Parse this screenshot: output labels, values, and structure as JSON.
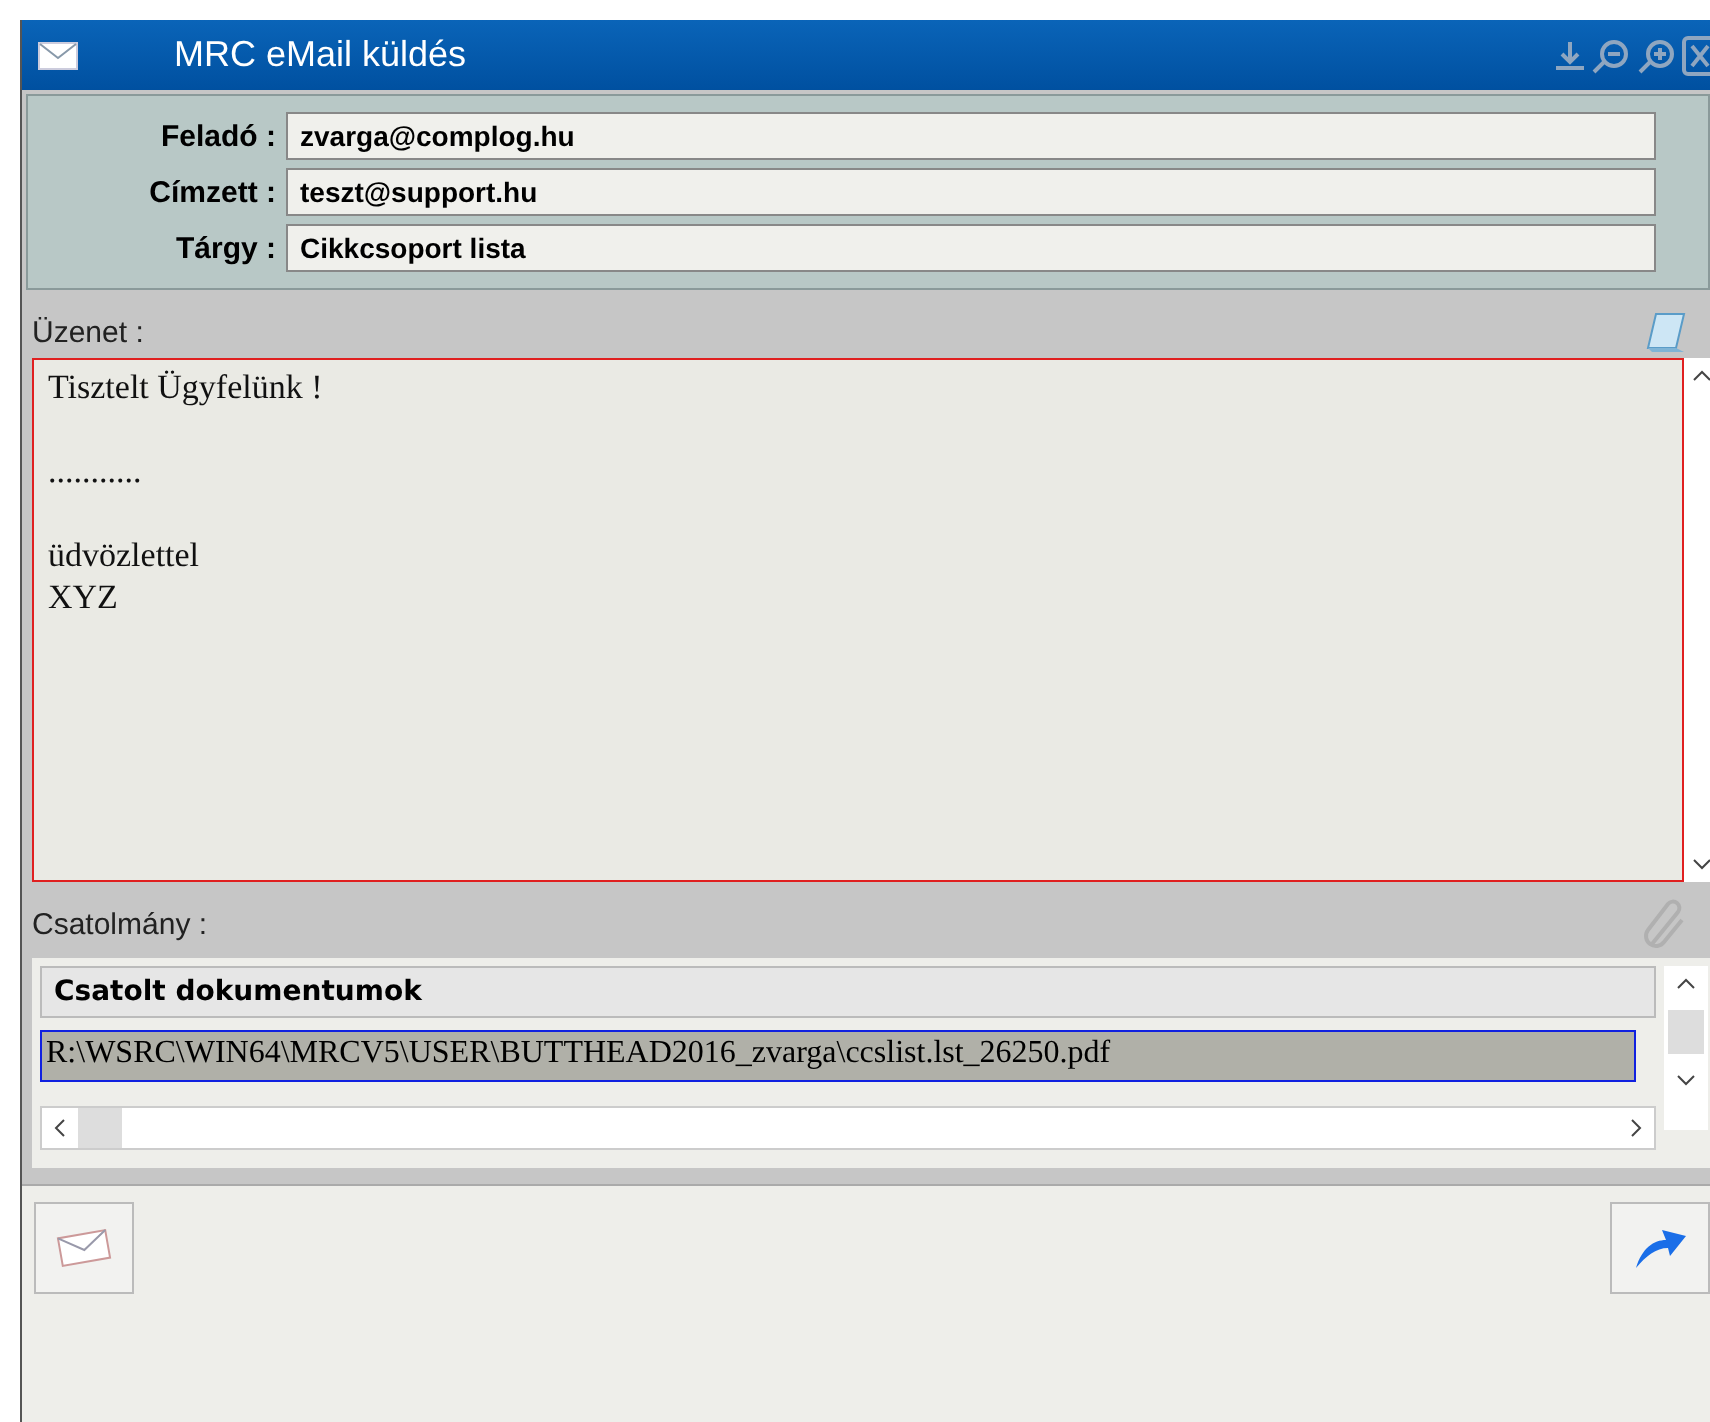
{
  "window": {
    "title": "MRC eMail küldés"
  },
  "header_fields": [
    {
      "label": "Feladó :",
      "value": "zvarga@complog.hu"
    },
    {
      "label": "Címzett :",
      "value": "teszt@support.hu"
    },
    {
      "label": "Tárgy :",
      "value": "Cikkcsoport lista"
    }
  ],
  "message": {
    "label": "Üzenet :",
    "text": "Tisztelt Ügyfelünk !\n\n...........\n\nüdvözlettel\nXYZ"
  },
  "attachments": {
    "label": "Csatolmány :",
    "columns": [
      "Csatolt dokumentumok"
    ],
    "rows": [
      {
        "cells": [
          "R:\\WSRC\\WIN64\\MRCV5\\USER\\BUTTHEAD2016_zvarga\\ccslist.lst_26250.pdf"
        ],
        "selected": true
      }
    ]
  }
}
